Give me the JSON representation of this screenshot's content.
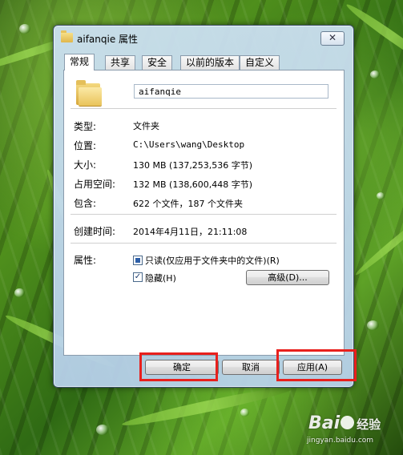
{
  "window": {
    "title": "aifanqie 属性",
    "close_label": "✕"
  },
  "tabs": [
    {
      "label": "常规",
      "active": true
    },
    {
      "label": "共享",
      "active": false
    },
    {
      "label": "安全",
      "active": false
    },
    {
      "label": "以前的版本",
      "active": false
    },
    {
      "label": "自定义",
      "active": false
    }
  ],
  "general": {
    "name_value": "aifanqie",
    "type_label": "类型:",
    "type_value": "文件夹",
    "location_label": "位置:",
    "location_value": "C:\\Users\\wang\\Desktop",
    "size_label": "大小:",
    "size_value": "130 MB (137,253,536 字节)",
    "size_on_disk_label": "占用空间:",
    "size_on_disk_value": "132 MB (138,600,448 字节)",
    "contains_label": "包含:",
    "contains_value": "622 个文件，187 个文件夹",
    "created_label": "创建时间:",
    "created_value": "2014年4月11日，21:11:08",
    "attributes_label": "属性:",
    "readonly_label": "只读(仅应用于文件夹中的文件)(R)",
    "readonly_state": "indeterminate",
    "hidden_label": "隐藏(H)",
    "hidden_state": "checked",
    "advanced_label": "高级(D)..."
  },
  "footer": {
    "ok_label": "确定",
    "cancel_label": "取消",
    "apply_label": "应用(A)"
  },
  "colors": {
    "highlight": "#e8201d"
  },
  "watermark": {
    "brand": "Bai",
    "brand_suffix": "经验",
    "url": "jingyan.baidu.com"
  }
}
